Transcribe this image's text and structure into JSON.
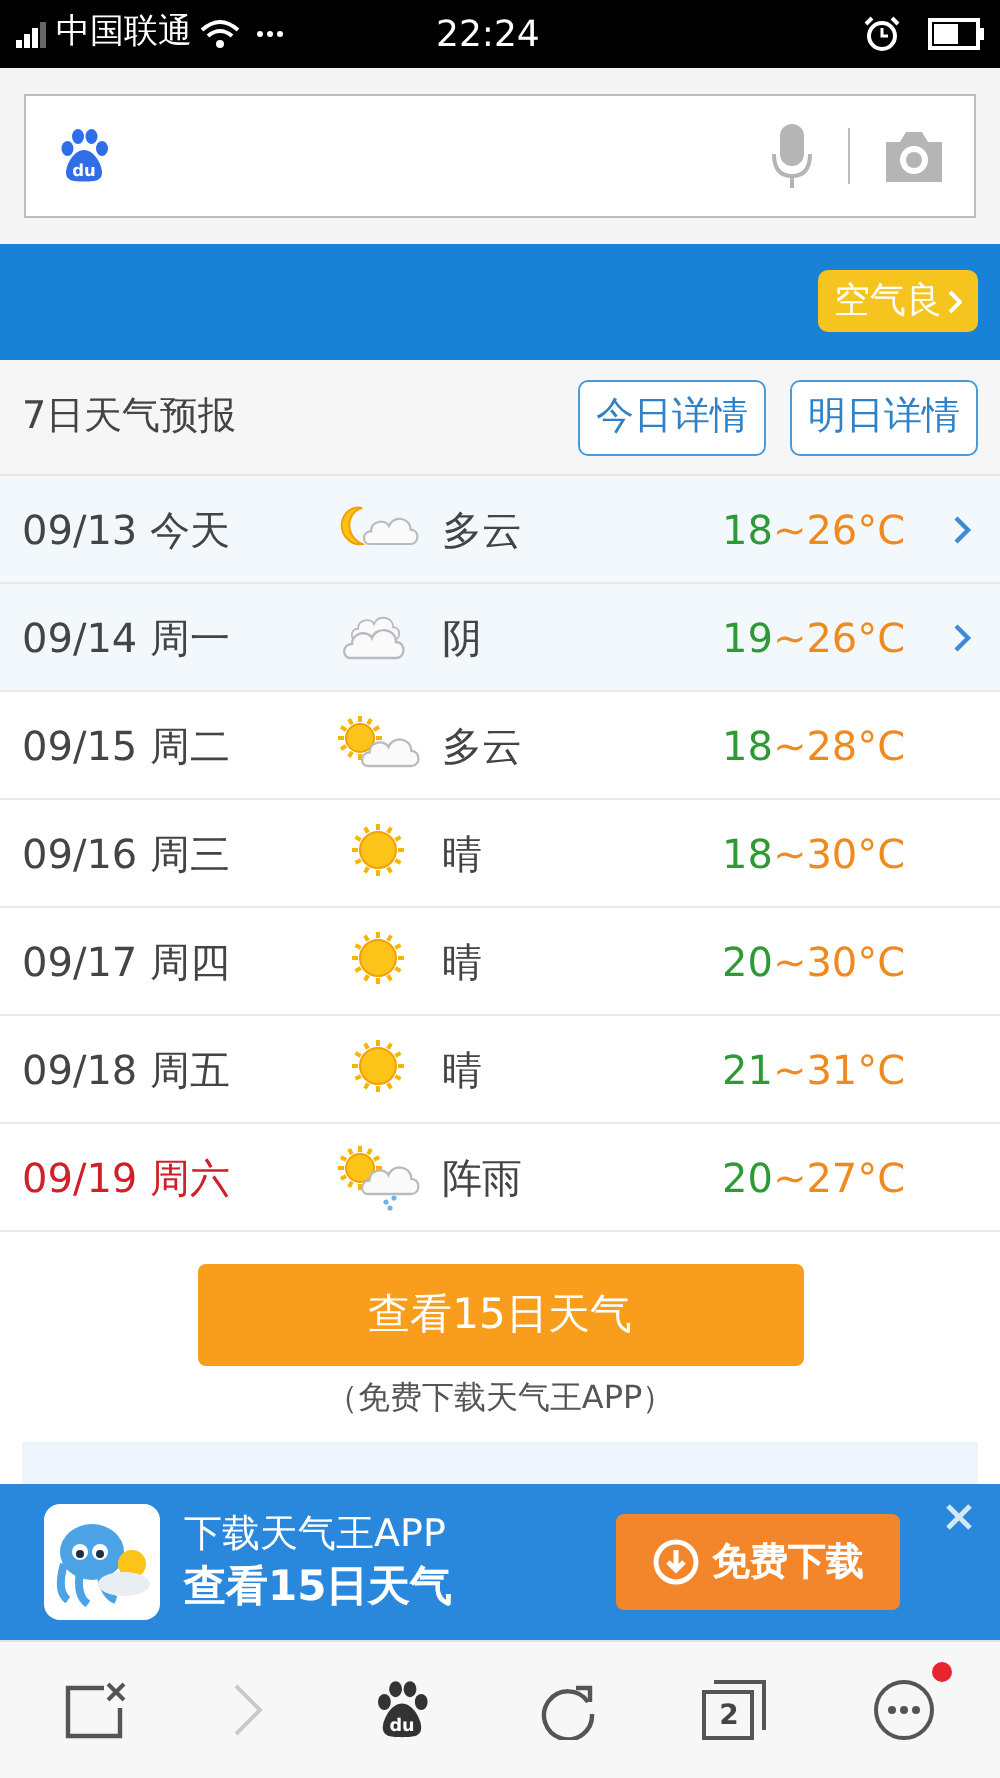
{
  "status_bar": {
    "carrier": "中国联通",
    "time": "22:24"
  },
  "search": {
    "logo_text": "du"
  },
  "air_quality": {
    "label": "空气良"
  },
  "forecast": {
    "title": "7日天气预报",
    "buttons": [
      "今日详情",
      "明日详情"
    ],
    "days": [
      {
        "date": "09/13",
        "day": "今天",
        "kind": "moon_cloud",
        "condition": "多云",
        "low": "18",
        "high": "~26°C",
        "weekend": false,
        "linked": true
      },
      {
        "date": "09/14",
        "day": "周一",
        "kind": "cloud",
        "condition": "阴",
        "low": "19",
        "high": "~26°C",
        "weekend": false,
        "linked": true
      },
      {
        "date": "09/15",
        "day": "周二",
        "kind": "sun_cloud",
        "condition": "多云",
        "low": "18",
        "high": "~28°C",
        "weekend": false,
        "linked": false
      },
      {
        "date": "09/16",
        "day": "周三",
        "kind": "sun",
        "condition": "晴",
        "low": "18",
        "high": "~30°C",
        "weekend": false,
        "linked": false
      },
      {
        "date": "09/17",
        "day": "周四",
        "kind": "sun",
        "condition": "晴",
        "low": "20",
        "high": "~30°C",
        "weekend": false,
        "linked": false
      },
      {
        "date": "09/18",
        "day": "周五",
        "kind": "sun",
        "condition": "晴",
        "low": "21",
        "high": "~31°C",
        "weekend": false,
        "linked": false
      },
      {
        "date": "09/19",
        "day": "周六",
        "kind": "sun_rain",
        "condition": "阵雨",
        "low": "20",
        "high": "~27°C",
        "weekend": true,
        "linked": false
      }
    ]
  },
  "more_button": {
    "label": "查看15日天气",
    "note": "（免费下载天气王APP）"
  },
  "app_banner": {
    "line1": "下载天气王APP",
    "line2": "查看15日天气",
    "button": "免费下载"
  },
  "toolbar": {
    "logo_text": "du",
    "tab_count": "2",
    "menu_badge": true
  }
}
